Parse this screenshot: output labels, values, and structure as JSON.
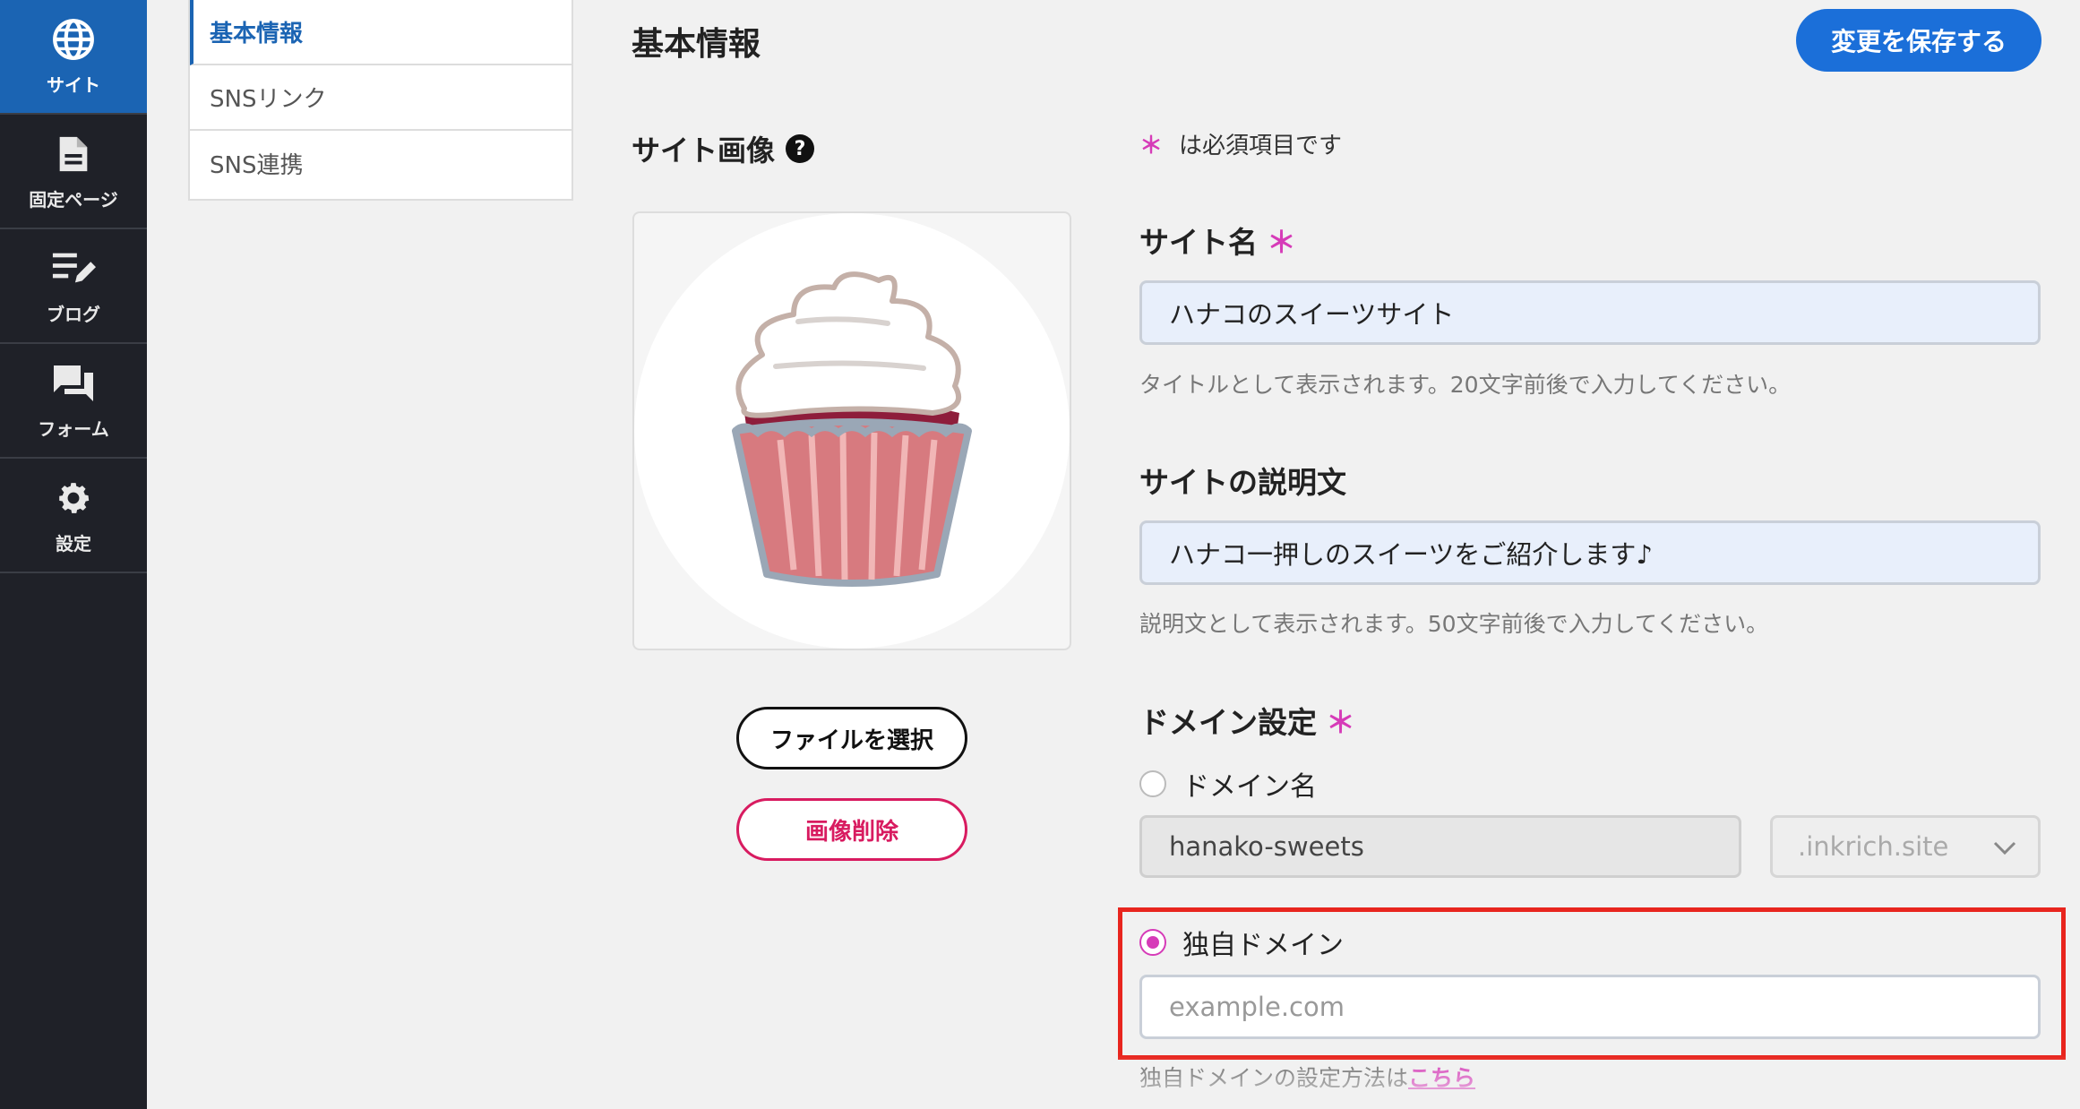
{
  "sidebar": {
    "items": [
      {
        "label": "サイト",
        "icon": "globe-icon",
        "active": true
      },
      {
        "label": "固定ページ",
        "icon": "document-icon"
      },
      {
        "label": "ブログ",
        "icon": "edit-list-icon"
      },
      {
        "label": "フォーム",
        "icon": "forum-icon"
      },
      {
        "label": "設定",
        "icon": "gear-icon"
      }
    ]
  },
  "subnav": {
    "items": [
      {
        "label": "基本情報",
        "active": true
      },
      {
        "label": "SNSリンク"
      },
      {
        "label": "SNS連携"
      }
    ]
  },
  "header": {
    "title": "基本情報",
    "save_label": "変更を保存する"
  },
  "site_image": {
    "heading": "サイト画像",
    "help_glyph": "?",
    "file_button": "ファイルを選択",
    "delete_button": "画像削除"
  },
  "form": {
    "required_mark": "＊",
    "required_note": "は必須項目です",
    "site_name": {
      "label": "サイト名",
      "value": "ハナコのスイーツサイト",
      "hint": "タイトルとして表示されます。20文字前後で入力してください。"
    },
    "site_description": {
      "label": "サイトの説明文",
      "value": "ハナコ一押しのスイーツをご紹介します♪",
      "hint": "説明文として表示されます。50文字前後で入力してください。"
    },
    "domain": {
      "label": "ドメイン設定",
      "option_subdomain": "ドメイン名",
      "subdomain_value": "hanako-sweets",
      "tld_value": ".inkrich.site",
      "option_custom": "独自ドメイン",
      "custom_placeholder": "example.com",
      "custom_hint": "独自ドメインの設定方法は",
      "custom_hint_link": "こちら",
      "selected": "custom"
    }
  },
  "colors": {
    "sidebar_bg": "#1f2128",
    "active_blue": "#1b64b3",
    "save_button": "#1b6fd9",
    "required_pink": "#d63bb8",
    "delete_red": "#d81b60",
    "highlight_red": "#e8251e"
  }
}
